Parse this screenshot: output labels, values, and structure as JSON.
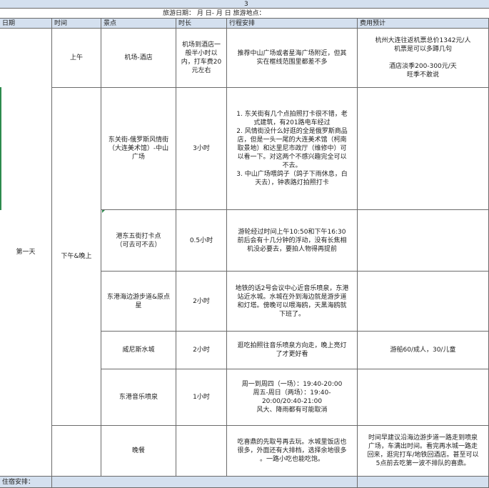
{
  "title_row": {
    "page_number": "3"
  },
  "date_row": {
    "label": "旅游日期：     月        日-     月       日        旅游地点："
  },
  "columns": [
    "日期",
    "时间",
    "景点",
    "时长",
    "行程安排",
    "费用预计"
  ],
  "day_label": "第一天",
  "morning_label": "上午",
  "afternoon_label": "下午&晚上",
  "rows": [
    {
      "spot": "机场-酒店",
      "duration": "机场到酒店一\n般半小时以\n内，打车费20\n元左右",
      "plan": "推荐中山广场或者星海广场附近，但其\n实在框线范围里都差不多",
      "cost": "杭州大连往返机票总价1342元/人\n机票是可以多蹲几句\n\n酒店淡季200-300元/天\n旺季不敢说"
    },
    {
      "spot": "东关街-俄罗斯风情街\n（大连美术馆）-中山\n广场",
      "duration": "3小时",
      "plan": "1. 东关街有几个点拍照打卡很不错，老\n式建筑，有201路电车经过\n2. 风情街没什么好逛的全是俄罗斯商品\n店，但是一头一尾的大连美术馆（柯南\n取景地）和达里尼市政厅（维修中）可\n以看一下。对这两个不感兴趣完全可以\n不去。\n3. 中山广场喂鸽子（鸽子下雨休息，白\n天去），钟表路灯拍照打卡",
      "cost": ""
    },
    {
      "spot": "港东五街打卡点\n（可去可不去）",
      "duration": "0.5小时",
      "plan": "游轮经过时间上午10:50和下午16:30\n前后会有十几分钟的浮动，没有长焦相\n机没必要去，要拍人物得再提前",
      "cost": ""
    },
    {
      "spot": "东港海边游步道&原点\n星",
      "duration": "2小时",
      "plan": "地铁的话2号会议中心近音乐喷泉，东港\n站近水城。水城在外到海边就是游步道\n和灯塔。傍晚可以喂海鸥，天黑海鸥就\n下班了。",
      "cost": ""
    },
    {
      "spot": "威尼斯水城",
      "duration": "2小时",
      "plan": "逛吃拍照往音乐喷泉方向走，晚上亮灯\n了才更好看",
      "cost": "游船60/成人，30/儿童"
    },
    {
      "spot": "东港音乐喷泉",
      "duration": "1小时",
      "plan": "周一到周四（一场）：19:40-20:00\n周五-周日（两场）：19:40-\n20:00/20:40-21:00\n风大、降雨都有可能取消",
      "cost": ""
    }
  ],
  "dinner": {
    "spot": "晚餐",
    "plan": "吃喜鼎的先取号再去玩。水城里饭店也\n很多，外面还有大排档，选择余地很多\n。一路小吃也能吃饱。",
    "cost": "时间早建议沿海边游步道一路走到喷泉\n广场，车满出时间。看完再水城一路走\n回来，逛完打车/地铁回酒店。甚至可以\n5点前去吃第一波不排队的喜鼎。"
  },
  "footer": {
    "label": "住宿安排："
  }
}
